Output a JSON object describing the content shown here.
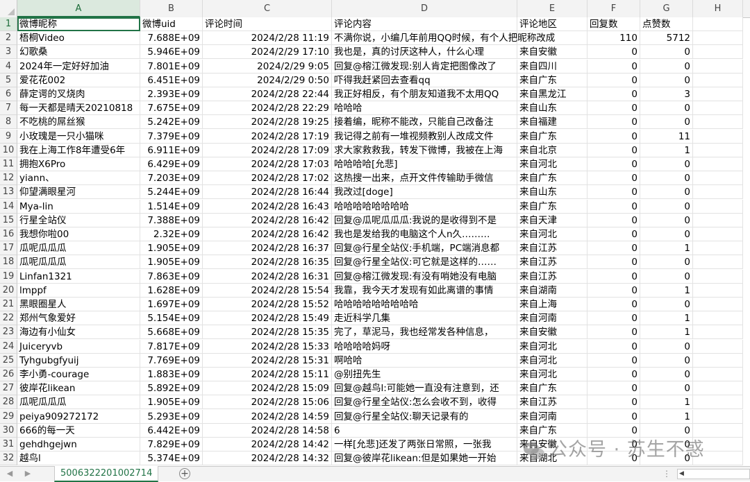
{
  "columns": [
    "A",
    "B",
    "C",
    "D",
    "E",
    "F",
    "G",
    "H"
  ],
  "headers": [
    "微博昵称",
    "微博uid",
    "评论时间",
    "评论内容",
    "评论地区",
    "回复数",
    "点赞数"
  ],
  "rows": [
    [
      "梧桐Video",
      "7.688E+09",
      "2024/2/28 11:19",
      "不满你说，小编几年前用QQ时候，有个人把昵称改成",
      "",
      "110",
      "5712"
    ],
    [
      "幻歌桑",
      "5.946E+09",
      "2024/2/29 17:10",
      "我也是，真的讨厌这种人，什么心理",
      "来自安徽",
      "0",
      "0"
    ],
    [
      "2024年一定好好加油",
      "7.801E+09",
      "2024/2/29 9:05",
      "回复@榕江微发现:别人肯定把图像改了",
      "来自四川",
      "0",
      "0"
    ],
    [
      "爱花花002",
      "6.451E+09",
      "2024/2/29 0:50",
      "吓得我赶紧回去查看qq",
      "来自广东",
      "0",
      "0"
    ],
    [
      "薛定谔的叉烧肉",
      "2.393E+09",
      "2024/2/28 22:44",
      "我正好相反，有个朋友知道我不太用QQ",
      "来自黑龙江",
      "0",
      "3"
    ],
    [
      "每一天都是晴天20210818",
      "7.675E+09",
      "2024/2/28 22:29",
      "哈哈哈",
      "来自山东",
      "0",
      "0"
    ],
    [
      "不吃桃的屌丝猴",
      "5.242E+09",
      "2024/2/28 19:25",
      "接着编，昵称不能改，只能自己改备注",
      "来自福建",
      "0",
      "0"
    ],
    [
      "小玫瑰是一只小猫咪",
      "7.379E+09",
      "2024/2/28 17:19",
      "我记得之前有一堆视频教别人改成文件",
      "来自广东",
      "0",
      "11"
    ],
    [
      "我在上海工作8年遭受6年",
      "6.911E+09",
      "2024/2/28 17:09",
      "求大家救救我，转发下微博，我被在上海",
      "来自北京",
      "0",
      "1"
    ],
    [
      "拥抱X6Pro",
      "6.429E+09",
      "2024/2/28 17:03",
      "哈哈哈哈[允悲]",
      "来自河北",
      "0",
      "0"
    ],
    [
      "yiann、",
      "7.203E+09",
      "2024/2/28 17:02",
      "这热搜一出来，点开文件传输助手微信",
      "来自广东",
      "0",
      "0"
    ],
    [
      "仰望满眼星河",
      "5.244E+09",
      "2024/2/28 16:44",
      "我改过[doge]",
      "来自山东",
      "0",
      "0"
    ],
    [
      "Mya-lin",
      "1.514E+09",
      "2024/2/28 16:43",
      "哈哈哈哈哈哈哈哈",
      "来自广东",
      "0",
      "0"
    ],
    [
      "行星全站仪",
      "7.388E+09",
      "2024/2/28 16:42",
      "回复@瓜呢瓜瓜瓜:我说的是收得到不是",
      "来自天津",
      "0",
      "0"
    ],
    [
      "我想你啦00",
      "2.32E+09",
      "2024/2/28 16:42",
      "我也是发给我的电脑这个人n久………",
      "来自河北",
      "0",
      "0"
    ],
    [
      "瓜呢瓜瓜瓜",
      "1.905E+09",
      "2024/2/28 16:37",
      "回复@行星全站仪:手机端，PC端消息都",
      "来自江苏",
      "0",
      "1"
    ],
    [
      "瓜呢瓜瓜瓜",
      "1.905E+09",
      "2024/2/28 16:35",
      "回复@行星全站仪:可它就是这样的……",
      "来自江苏",
      "0",
      "0"
    ],
    [
      "Linfan1321",
      "7.863E+09",
      "2024/2/28 16:31",
      "回复@榕江微发现:有没有哨她没有电脑",
      "来自江苏",
      "0",
      "0"
    ],
    [
      "lmppf",
      "1.628E+09",
      "2024/2/28 15:54",
      "我靠，我今天才发现有如此离谱的事情",
      "来自湖南",
      "0",
      "1"
    ],
    [
      "黑眼圈星人",
      "1.697E+09",
      "2024/2/28 15:52",
      "哈哈哈哈哈哈哈哈哈",
      "来自上海",
      "0",
      "0"
    ],
    [
      "郑州气象爱好",
      "5.154E+09",
      "2024/2/28 15:49",
      "走近科学几集",
      "来自河南",
      "0",
      "1"
    ],
    [
      "海边有小仙女",
      "5.668E+09",
      "2024/2/28 15:35",
      "完了，草泥马，我也经常发各种信息，",
      "来自安徽",
      "0",
      "1"
    ],
    [
      "Juiceryvb",
      "7.817E+09",
      "2024/2/28 15:33",
      "哈哈哈哈妈呀",
      "来自河北",
      "0",
      "0"
    ],
    [
      "Tyhgubgfyuij",
      "7.769E+09",
      "2024/2/28 15:31",
      "啊哈哈",
      "来自河北",
      "0",
      "0"
    ],
    [
      "李小勇-courage",
      "1.883E+09",
      "2024/2/28 15:11",
      "@别扭先生",
      "来自河北",
      "0",
      "0"
    ],
    [
      "彼岸花likean",
      "5.892E+09",
      "2024/2/28 15:09",
      "回复@越鸟l:可能她一直没有注意到，还",
      "来自广东",
      "0",
      "0"
    ],
    [
      "瓜呢瓜瓜瓜",
      "1.905E+09",
      "2024/2/28 15:06",
      "回复@行星全站仪:怎么会收不到，收得",
      "来自江苏",
      "0",
      "1"
    ],
    [
      "peiya909272172",
      "5.293E+09",
      "2024/2/28 14:59",
      "回复@行星全站仪:聊天记录有的",
      "来自河南",
      "0",
      "1"
    ],
    [
      "666的每一天",
      "6.442E+09",
      "2024/2/28 14:58",
      "6",
      "来自广东",
      "0",
      "0"
    ],
    [
      "gehdhgejwn",
      "7.829E+09",
      "2024/2/28 14:42",
      "一样[允悲]还发了两张日常照，一张我",
      "来自安徽",
      "0",
      "0"
    ],
    [
      "越鸟l",
      "5.374E+09",
      "2024/2/28 14:32",
      "回复@彼岸花likean:但是如果她一开始",
      "来自湖北",
      "0",
      "0"
    ]
  ],
  "tabs": {
    "sheet_name": "5006322201002714",
    "add_label": "+"
  },
  "watermark": "公众号 · 苏生不惑",
  "accent": "#217346"
}
